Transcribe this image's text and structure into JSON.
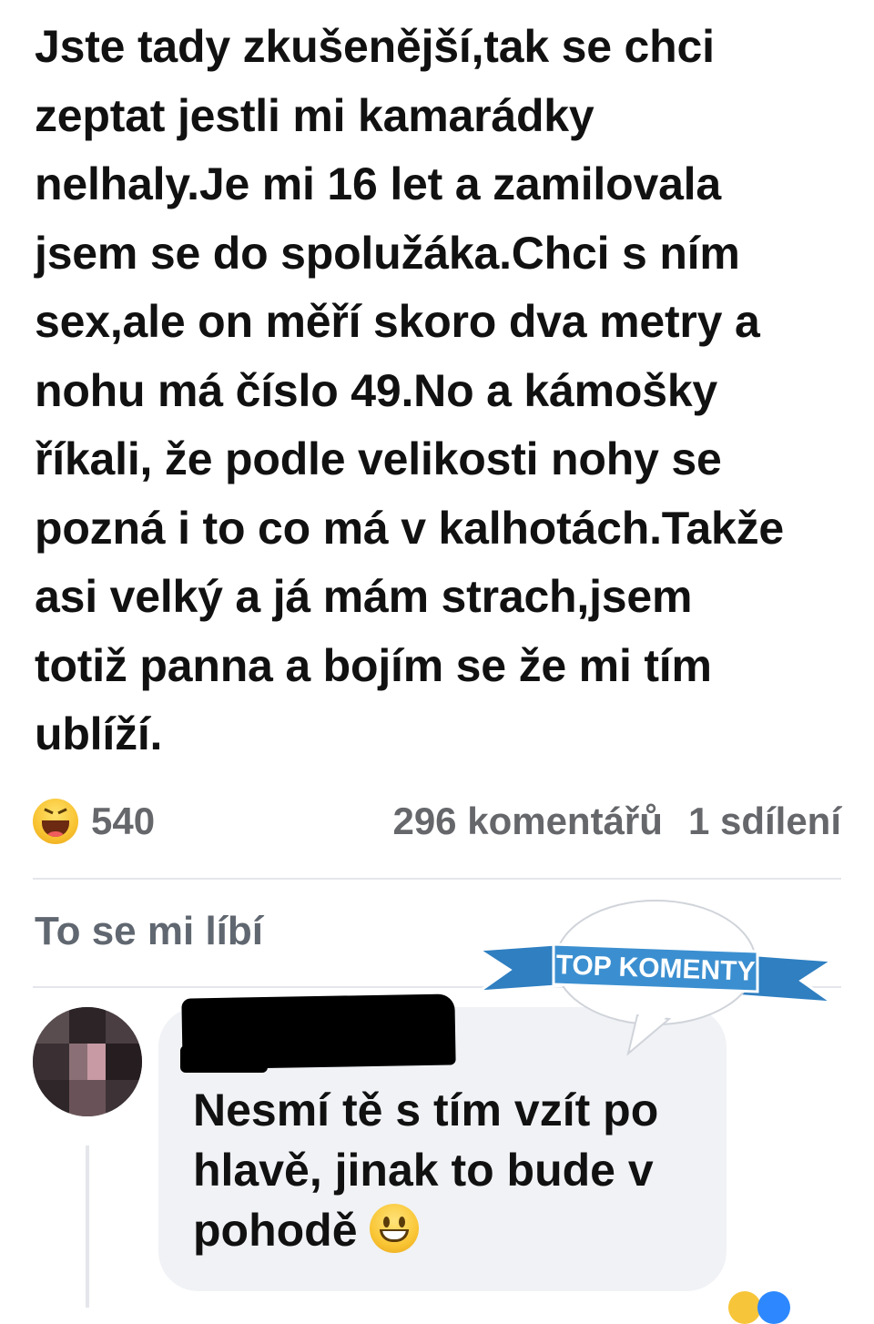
{
  "post": {
    "text": "Jste tady zkušenější,tak se chci\nzeptat jestli mi kamarádky\nnelhaly.Je mi 16 let a zamilovala\njsem se do spolužáka.Chci s ním\nsex,ale on měří skoro dva metry a\nnohu má číslo 49.No a kámošky\nříkali, že podle velikosti nohy se\npozná i to co má v kalhotách.Takže\nasi velký a já mám strach,jsem\ntotiž panna a bojím se že mi tím\nublíží."
  },
  "stats": {
    "reaction_icon": "haha-icon",
    "reaction_count": "540",
    "comments": "296 komentářů",
    "shares": "1 sdílení"
  },
  "actions": {
    "like_label": "To se mi líbí"
  },
  "badge": {
    "label": "TOP KOMENTY",
    "ribbon_color": "#3b8fd0",
    "bubble_color": "#ffffff"
  },
  "comment": {
    "text": "Nesmí tě s tím vzít po hlavě, jinak to bude v pohodě",
    "emoji": "smiley-icon"
  },
  "colors": {
    "text": "#111111",
    "muted": "#65676b",
    "bubble_bg": "#f0f2f5",
    "divider": "#e4e6eb"
  }
}
